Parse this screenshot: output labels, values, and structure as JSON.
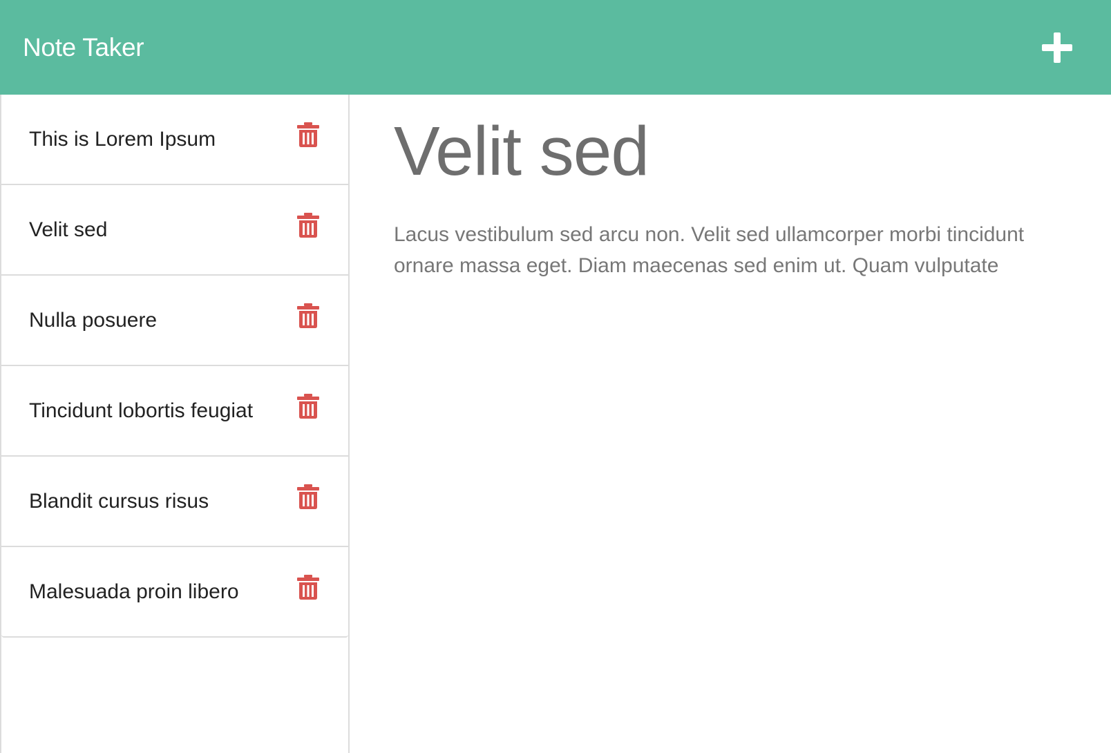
{
  "header": {
    "title": "Note Taker",
    "add_icon": "plus-icon"
  },
  "notes": [
    {
      "title": "This is Lorem Ipsum",
      "delete_icon": "trash-icon"
    },
    {
      "title": "Velit sed",
      "delete_icon": "trash-icon"
    },
    {
      "title": "Nulla posuere",
      "delete_icon": "trash-icon"
    },
    {
      "title": "Tincidunt lobortis feugiat",
      "delete_icon": "trash-icon"
    },
    {
      "title": "Blandit cursus risus",
      "delete_icon": "trash-icon"
    },
    {
      "title": "Malesuada proin libero",
      "delete_icon": "trash-icon"
    }
  ],
  "active_note": {
    "title": "Velit sed",
    "text": "Lacus vestibulum sed arcu non. Velit sed ullamcorper morbi tincidunt ornare massa eget. Diam maecenas sed enim ut. Quam vulputate"
  },
  "colors": {
    "navbar": "#5bbb9f",
    "delete": "#d9534f",
    "heading": "#6e6e6e"
  }
}
